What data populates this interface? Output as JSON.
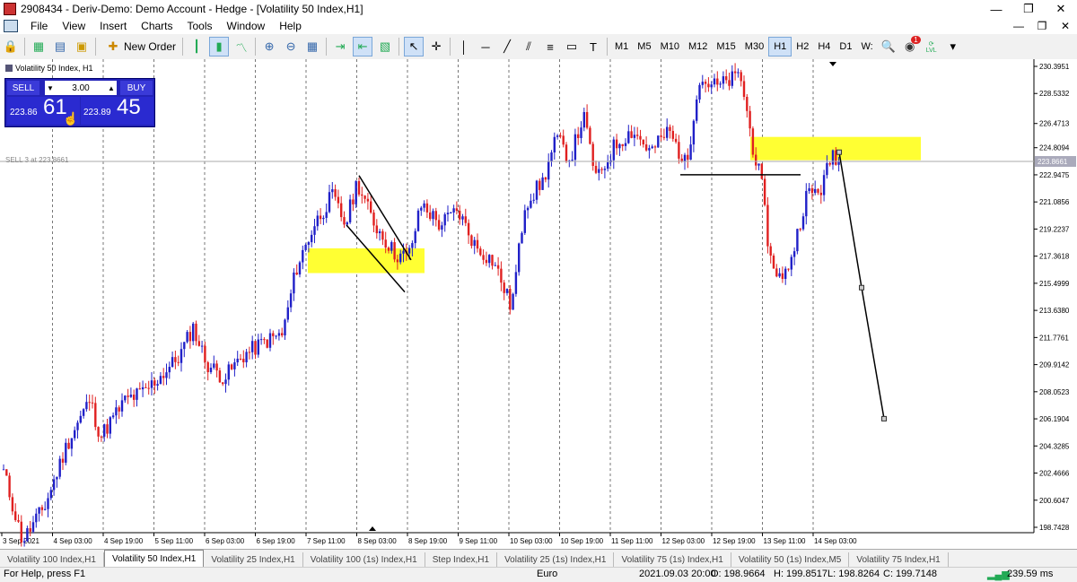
{
  "window": {
    "title": "2908434 - Deriv-Demo: Demo Account - Hedge - [Volatility 50 Index,H1]",
    "controls": [
      "—",
      "❐",
      "✕"
    ]
  },
  "menu": [
    "File",
    "View",
    "Insert",
    "Charts",
    "Tools",
    "Window",
    "Help"
  ],
  "mdi_controls": [
    "—",
    "❐",
    "✕"
  ],
  "toolbar": {
    "new_order_label": "New Order",
    "timeframes": [
      "M1",
      "M5",
      "M10",
      "M12",
      "M15",
      "M30",
      "H1",
      "H2",
      "H4",
      "D1",
      "W:"
    ],
    "active_timeframe": "H1",
    "notification_count": "1",
    "lvl_label": "LVL"
  },
  "chart": {
    "header": "Volatility 50 Index, H1",
    "one_click": {
      "sell_label": "SELL",
      "buy_label": "BUY",
      "volume": "3.00",
      "bid_small": "223.86",
      "bid_big": "61",
      "ask_small": "223.89",
      "ask_big": "45"
    },
    "sell_line_label": "SELL 3 at 223.8661",
    "price_axis": [
      "230.3951",
      "228.5332",
      "226.4713",
      "224.8094",
      "223.8661",
      "222.9475",
      "221.0856",
      "219.2237",
      "217.3618",
      "215.4999",
      "213.6380",
      "211.7761",
      "209.9142",
      "208.0523",
      "206.1904",
      "204.3285",
      "202.4666",
      "200.6047",
      "198.7428"
    ],
    "current_price": "223.8661",
    "time_axis": [
      "3 Sep 2021",
      "4 Sep 03:00",
      "4 Sep 19:00",
      "5 Sep 11:00",
      "6 Sep 03:00",
      "6 Sep 19:00",
      "7 Sep 11:00",
      "8 Sep 03:00",
      "8 Sep 19:00",
      "9 Sep 11:00",
      "10 Sep 03:00",
      "10 Sep 19:00",
      "11 Sep 11:00",
      "12 Sep 03:00",
      "12 Sep 19:00",
      "13 Sep 11:00",
      "14 Sep 03:00"
    ],
    "colors": {
      "bull": "#2020c8",
      "bear": "#e02020",
      "zone": "#ffff33",
      "line": "#000000"
    }
  },
  "tabs": [
    "Volatility 100 Index,H1",
    "Volatility 50 Index,H1",
    "Volatility 25 Index,H1",
    "Volatility 100 (1s) Index,H1",
    "Step Index,H1",
    "Volatility 25 (1s) Index,H1",
    "Volatility 75 (1s) Index,H1",
    "Volatility 50 (1s) Index,M5",
    "Volatility 75 Index,H1"
  ],
  "active_tab": "Volatility 50 Index,H1",
  "status": {
    "help": "For Help, press F1",
    "profile": "Euro",
    "time": "2021.09.03 20:00",
    "open": "O: 198.9664",
    "high": "H: 199.8517",
    "low": "L: 198.8264",
    "close": "C: 199.7148",
    "ping": "239.59 ms"
  }
}
